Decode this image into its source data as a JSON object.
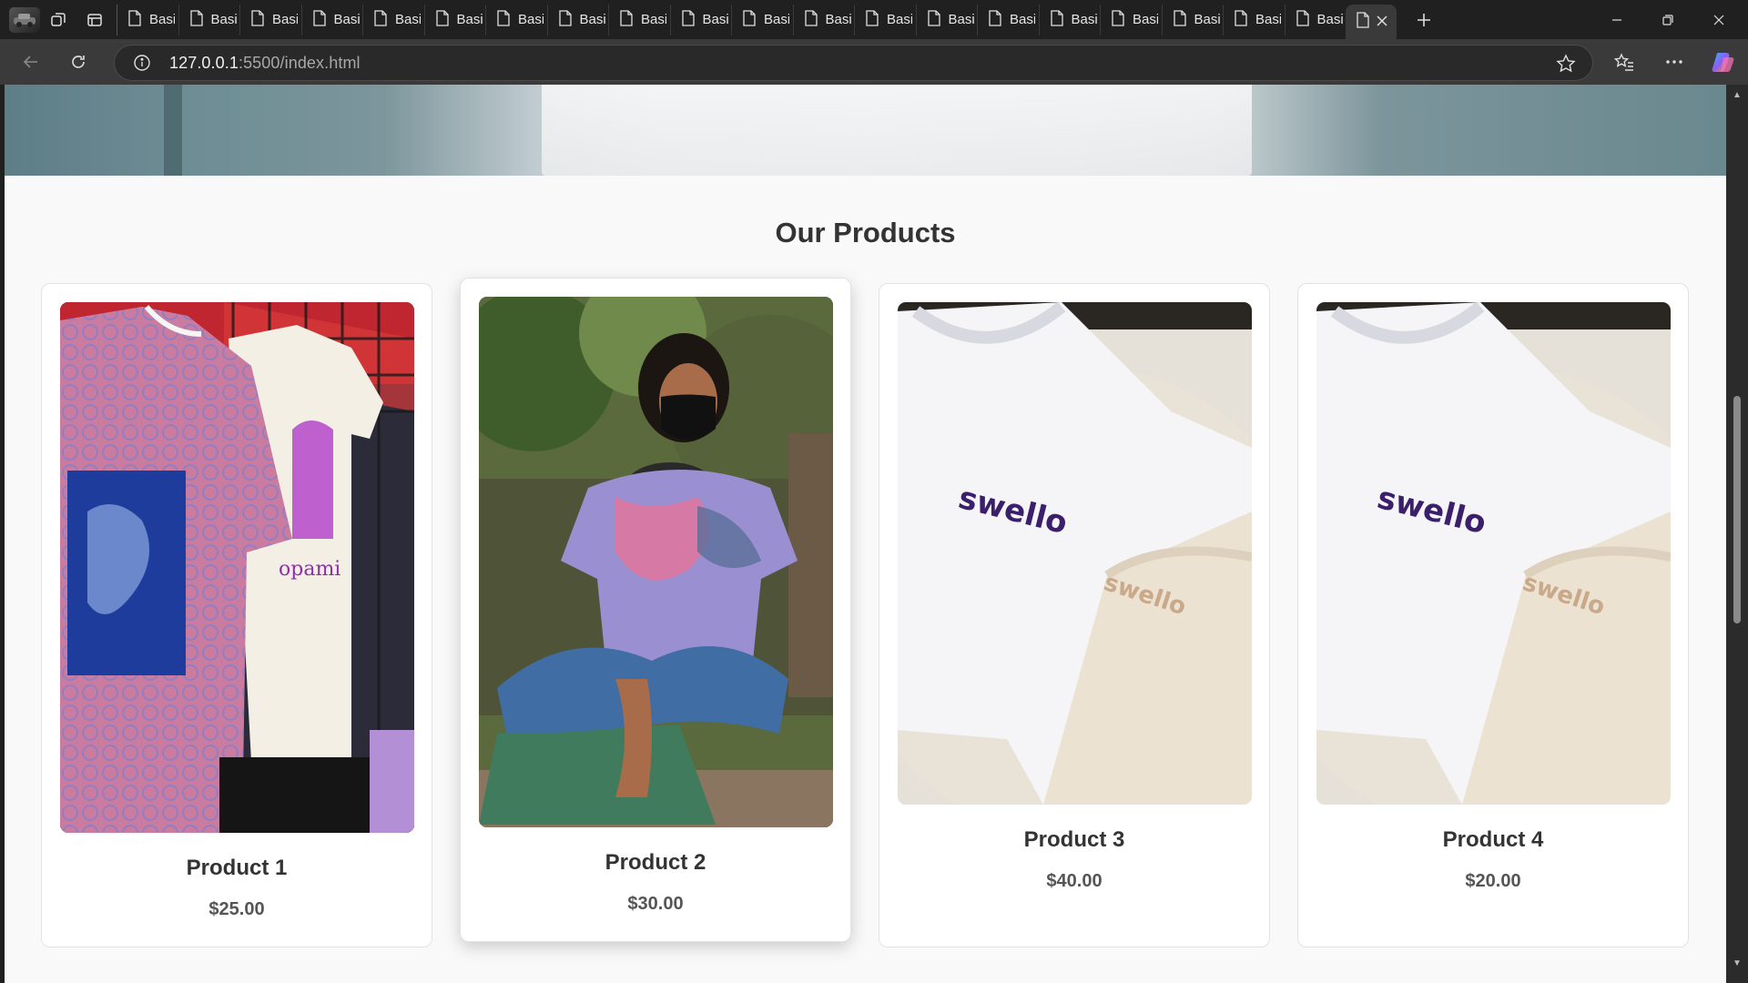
{
  "browser": {
    "tab_label": "Basi",
    "tab_count": 21,
    "url_host": "127.0.0.1",
    "url_path": ":5500/index.html"
  },
  "page": {
    "section_title": "Our Products",
    "products": [
      {
        "name": "Product 1",
        "price": "$25.00"
      },
      {
        "name": "Product 2",
        "price": "$30.00"
      },
      {
        "name": "Product 3",
        "price": "$40.00"
      },
      {
        "name": "Product 4",
        "price": "$20.00"
      }
    ],
    "swello_text": "swello"
  },
  "colors": {
    "accent_text": "#333333",
    "price_text": "#555555",
    "page_bg": "#f9f9f9"
  }
}
